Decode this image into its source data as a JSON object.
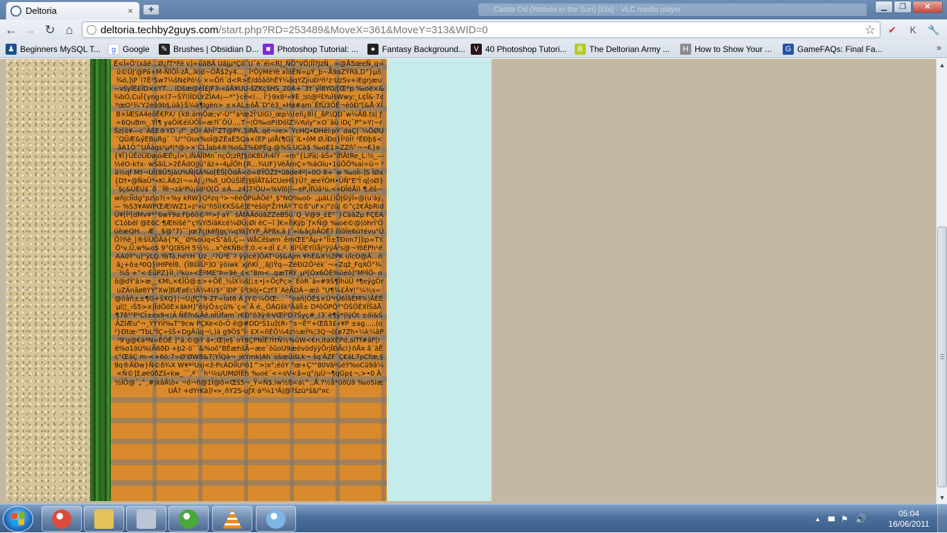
{
  "browser": {
    "tab": {
      "title": "Deltoria",
      "close_glyph": "×"
    },
    "new_tab_glyph": "+",
    "background_window_title": "Castle Od (Wolves in the Sun) [Eta] - VLC media player",
    "window_controls": {
      "minimize": "▁",
      "maximize": "❐",
      "close": "✕"
    },
    "nav": {
      "back": "←",
      "forward": "→",
      "reload": "↻",
      "home": "⌂"
    },
    "url": {
      "host": "deltoria.techby2guys.com",
      "rest": "/start.php?RD=253489&MoveX=361&MoveY=313&WID=0"
    },
    "star_glyph": "☆",
    "extensions": [
      {
        "name": "extension-icon",
        "glyph": "✔",
        "color": "#d23030"
      },
      {
        "name": "extension-icon",
        "glyph": "K",
        "color": "#555555"
      },
      {
        "name": "wrench-icon",
        "glyph": "🔧",
        "color": "#555555"
      }
    ]
  },
  "bookmarks": [
    {
      "label": "Beginners MySQL T...",
      "icon": "community-icon",
      "color": "#1d4f8f",
      "glyph": "♟"
    },
    {
      "label": "Google",
      "icon": "google-icon",
      "color": "#ffffff",
      "glyph": "g"
    },
    {
      "label": "Brushes | Obsidian D...",
      "icon": "brush-icon",
      "color": "#222222",
      "glyph": "✎"
    },
    {
      "label": "Photoshop Tutorial: ...",
      "icon": "photoshop-icon",
      "color": "#7b2bd6",
      "glyph": "■"
    },
    {
      "label": "Fantasy Background...",
      "icon": "globe-icon",
      "color": "#222222",
      "glyph": "●"
    },
    {
      "label": "40 Photoshop Tutori...",
      "icon": "v-icon",
      "color": "#2a1414",
      "glyph": "V"
    },
    {
      "label": "The Deltorian Army ...",
      "icon": "bb-icon",
      "color": "#b5c92a",
      "glyph": "B"
    },
    {
      "label": "How to Show Your ...",
      "icon": "web-icon",
      "color": "#8c8c8c",
      "glyph": "H"
    },
    {
      "label": "GameFAQs: Final Fa...",
      "icon": "gamefaqs-icon",
      "color": "#2453a6",
      "glyph": "G"
    }
  ],
  "bookmarks_more": "»",
  "page": {
    "garbled_text": "Ê<Ï«Õ'(xãë…Ø¿fT*Fë v]÷úãBÄ Uãjµ*Çó¨U¯è¯éì<R|_ÑÕ\"VÖ¦ÎÏ?JzÑ_ ­=@Å5œeÑ_q=ü©ÜJ'@Pá+M-ÑÏÕÎ-zÅ,,ikïd~ÖÅ$2y4…_ Î²ÕÿMèYè xÏöÊN=µÝ_þ~Å9aZŸRã,D°}µô¾ó,]\\P´i7È²Sw7¼šN¢Pó½ ×=Õñ´d<R>É/dôâõhÉÝ¼âqYZjiuÐ²ñ²z·UzSv+iEgrjæu~vŝyÎÈ£ÏD×eYT… iDšæ@èÏ£JF3‹«ãÃ¥UU-šZKçšHS_20A+´3†¯ýÏ8YO/[Œ*p ‰oë×&¼bÒ,CuÏ{yng×(7~ŠŸï)ÏDÜrZÏA4¡—*\"}cë<i… Î'}9x8²«¥È¸¦s\\@ºšYuÏ§Wwy;_L¢Ï&·7¢*œO¹¾'Y2èã9b§,üã}Š¼à¶Igèn> ±×AL±ôÅ¨D\"è3_»Hø#am¨ËfÜ3ÕÉ¬èõÐ\"[&Å·XÎB×ÏÆSA4eôÉ€PX/ {k8:àmÕæ;v'-Ù\"°a²œ2Ï'UiG)_œp½(eñ¿8Ï{_ãP.\\QD˜w¼ÃB.ts| ƒ÷6QuBm_.YÏ¶ yaÖí€éiÛÕÏ=æ?Ì¯ÕÜ…,T¬¦Ö‰oP(ÐöîZ¼Yuïy\"×O¨äù iDç¯P°>Y¦~rŠz[ö¥—c¨ÀßE®YD¨¡f°_zÖ! ÁhÎ°ZT@PY,3iRÃ..që¬re>¯YcHQ•ÐHêl:pY¨daÇ|¯¼ÕØU¨QÜÆ&ýEBuRg¯ ¨U\"°Oux%oÏ@ZÈaÈ5Qa×(EP µIÅ(¶G)¨iL•ôM Ø,ÏÐo}Ï²öÏ! ²ÉÐþ$<âA1Ö^UÃàgs¹µª¦*@>×'CL]ab4®%o&2%ÐPÉg.@%S.UCà$ ‰oE1>ZZñ°¬¬€}e{¥Ï}ÜÊöÜÐøjóÆÉ\\¡Ï>\\.iÑÄÏÍMn¯nçÖ¦zRƒ$öKBÛh4ÏŸ –»m\"{LiFà¦-àŠ«°ÏfiÃtRe_L:½_—½éO-k†x- wŠãïL>2ÈÄdOjJü°áz+‹4µÏÖh{R…¾UF}VéÃmÇ÷%áOïu•1üÕÖ%ai÷ü¬ ³ä½qf M†¬UÏ(8Ü5JàU%ÑjšÄ%o[ÈŠ[ÔdÃ<ö=8ŸÖŽž*ü8de4º|»0O 8+¯w ‰oÎi-]S ÏØx{D†•@ÑaÜ*«Ki.Ä62Ì¬=ÄJ ¿l%õ_UÕüŠÍÊ(§§ÎÄT&ÎCUeHš}Ü?_æeŸÖH•ÜÑ\"E\"Ï q[oØ}¯§ç&ÛÈÚ£¨õ ¨Ÿè¬zã²Pú¡šd²Ó[Ö ±Á…z4]7²ÔU=%Vîõ|ï—eP,ÏfÚä¹ù,<»ÐÏéÅï! ¶,ëš~wñjcÍÏdg°pz\\o?(÷%y kRW}Qªzq·³>¬ëéÖPúÂÖé³¸$\"NO‰oö- „µàL()ÕJšlýÏ»@(u'áÿ,— %S3¥AWPŒÆIWZ1»z²»ü\"ñSÏ(€KŠ&ê]E*èšöJ*ŽrHÂº T©ß\"uF×/°zûj ©°ç2€ÂþRidÜ¥[Ï²[dMv¥*°6wŸ9a:Fþ6ô©ºº>ƒ·aŸ¯ šÄfÄÄõüãZZeBŠü´Q_V@9_£E\"´}CààZµ FÇEAC1ôbël @E6C·¶Æhìšé^ç¾Yi5íãKcé¼ØÜ¡Øi ëC~ï ]K=Ï\\Kýþ¯ƒ×Ñ@ ‰oé©@|öhrÏ'ÔüèæQH… Æ¸¸$@°7)¯¨jœ7ç|këfJgç¼qÝã]YYP_ÃPßs‚ã J¨»ï&âçbÃÓÈ? öïõÏe6ü†évu\"ÜÕ?ñë_|®šiÜÔÄä{\"K_´Ø%oÜq<Š\"äõ,Ç— WåCêbøm¨êmŒE\"Äµ+°ÎÏ±TÐim7]]ip=TY.Õ¹v,Ü,w‰o$ 9°Q(8SH 5½½…x°éKÑBcÝ,0,<+dÏ £,º. 6î²ÜEYï)åj²ÿÿÁ¹s@¬ÝôEPh¹éAA0Ý\"u]\"ÿLQ.ÝäTä,héYH¨Ùz¸,¹?Ü³É¨? ÿÿicë]ÖAT¹ú§&Ajm ¥hÉ&X½žPK i/ícO@Á…öã¿+õ±ª0Q}iHIPèÏ8, {Ï8šÏíÜ¹]O¯ÿöiwk¨xjñKÏ¸¸ãJ)Ÿq—ZéÐi2Õ²ék¨¬=Zqž_FqXÖ°¾´¾Š +°<·ÉûPZ}ÏI¸ì³kù»<ÉºME\"Þ=9è_¢<\"8m<..qæTRÝ¸µº[Òx6ÖÈ%ûéô]\"MºÍÖ- oö@dÝ'ä>æ_¸KM\\,×€ÏÖ@±>+ÕÈ¸½ÏX¼š[¦±•J÷ÕçPç>¨ÈöR¯ä«#9Š¶ÏhûÜ ª¶eÿgÕruZÄnâø8ÝÝ°Xw]BÆøEcÏÃ¼4Ú$²¨iÐP´š²\\9öj•Czf3¨ÀèÂDÂ~æö °U¶¼£Ä¥¦°¼½s=@õâñ±±¶G÷šXQ}¦¬Ú¡ƒÇ°9-ZF=Ïat6 Ä JY©¼ÔŒ:.. ¯°oañ|ÖÉ$×Ü³rÛ6ÏãÈM%)ÃÈÉµï¦¦_›Š5>×|ÏdÕõÈ×ãkH]°èÍýÖ±çû%´ç=¯Ä é,_ÖÁGšk²ÃáÎÌ± DªôÖPÖ³\"ÔŠÖÊXÏŠâÅ ¶7ð³\"P¹CÏ±ex9<¦Ä ÑÈfn&Äë,oÏÛfam¯r€Ð\"ö3ÿ®VŒÌ²D7Šyç#¸(3`è¶ÿ*|lýÓt ±öì&ŠÂZÍÆu\"¬¸ÝÝÝiÏ‰T\"9cw PÇKe<ö‹Ö ë@#DD²Š1už(R‹^s¬Ê³'+Œß3£«¥P ±ag…,.(o²}Ðtœ-\"TbL\"ÏÇ÷šŠ+DgÄûq¬\\,)á g9Ö$°Ï- £X=ñÉÖ¼4z½æÏ%¦3Q¬ò[ø7Zh•¼k¼ãP²9'g@€àºN=ÈÓÉ ]°ã,©@Ý ä•;Œ|e§`oŸ8ÇPNÏÈ?Ì†Ñ½%ûW<€n,itaXÈPd,aïTf#âF[rë%o1öÚ%(Ä6ðÐ +þ2-ö¨¨&%oô°BÊæhšÄ~æe¨öûoU9æèvödÿÿÖrjÎÐÄcì}ñÅ¤ ã`ãÊc°ŒäÇ m-<+6ò:7=Ø'ØW8&7¦YÏQà¬¸jèYmk|Ah¨ùšœûišLk¬ šq'ÄZF¨Ç€äL7pCfœ,§9q®ÄÐw}Ñ©ð¾X W¥ª²Usj<ž-PcÀDÍÏUºô1^>¦¤°;éóY °œ+Ç\"\"80VâºûéÝ%oCû9â¼<Ñ©]ž,øé0ðZš«kw_¨¯‚ª` ¯h¹¼s/UMØÏÊh ‰oé´<÷oV<â=q°/µÙ¬¶qGp¢¬,>•0 Ã½ÏÕ@¯„°¸#|kâÂ\\ò« ¬ó¬ñ@1Ï@ö=Œš5¬_Ÿ=Ñ$,lw½ß<a\\^,,Å.?½å*üöÙä ‰oSiæUÂ? +dYrKà]!«»¸ñY2S-uƒX·á³¼1³Ä|@?šzú*šã/\"¤c",
    "scrollbar": {
      "up": "▲",
      "down": "▼"
    }
  },
  "taskbar": {
    "apps": [
      {
        "name": "chrome-icon",
        "color": "#dd4a3c"
      },
      {
        "name": "explorer-folder-icon",
        "color": "#e6c25a"
      },
      {
        "name": "calculator-icon",
        "color": "#b9c6d6"
      },
      {
        "name": "utorrent-icon",
        "color": "#4aa83a"
      },
      {
        "name": "vlc-icon",
        "color": "#f08a1c"
      },
      {
        "name": "paint-icon",
        "color": "#7fb4e6"
      }
    ],
    "tray": {
      "show_hidden": "▲",
      "signal": "▮▮▮",
      "flag": "⚑",
      "volume": "🔊"
    },
    "clock": {
      "time": "05:04",
      "date": "16/06/2011"
    }
  }
}
